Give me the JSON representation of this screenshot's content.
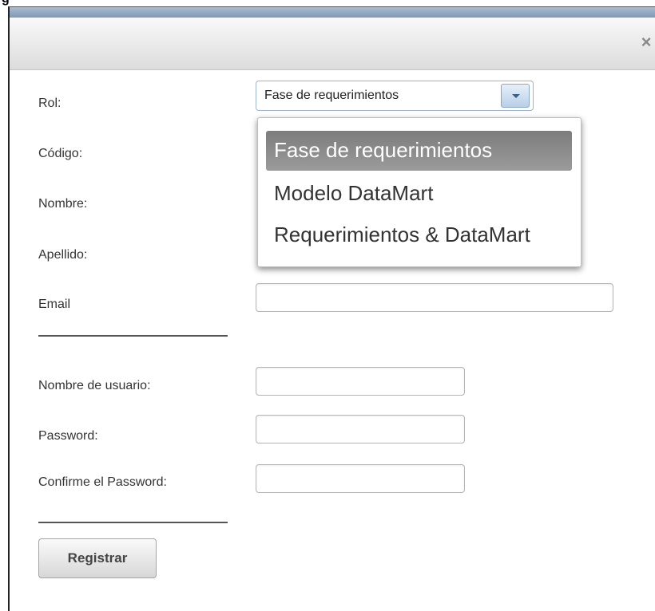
{
  "page": {
    "clipped_heading": "g"
  },
  "dialog": {
    "close_icon": "close-icon"
  },
  "form": {
    "fields": [
      {
        "label": "Rol:"
      },
      {
        "label": "Código:"
      },
      {
        "label": "Nombre:"
      },
      {
        "label": "Apellido:"
      },
      {
        "label": "Email"
      },
      {
        "label": "Nombre de usuario:"
      },
      {
        "label": "Password:"
      },
      {
        "label": "Confirme el Password:"
      }
    ],
    "role_select": {
      "value": "Fase de requerimientos",
      "options": [
        "Fase de requerimientos",
        "Modelo DataMart",
        "Requerimientos & DataMart"
      ]
    },
    "submit_label": "Registrar"
  }
}
